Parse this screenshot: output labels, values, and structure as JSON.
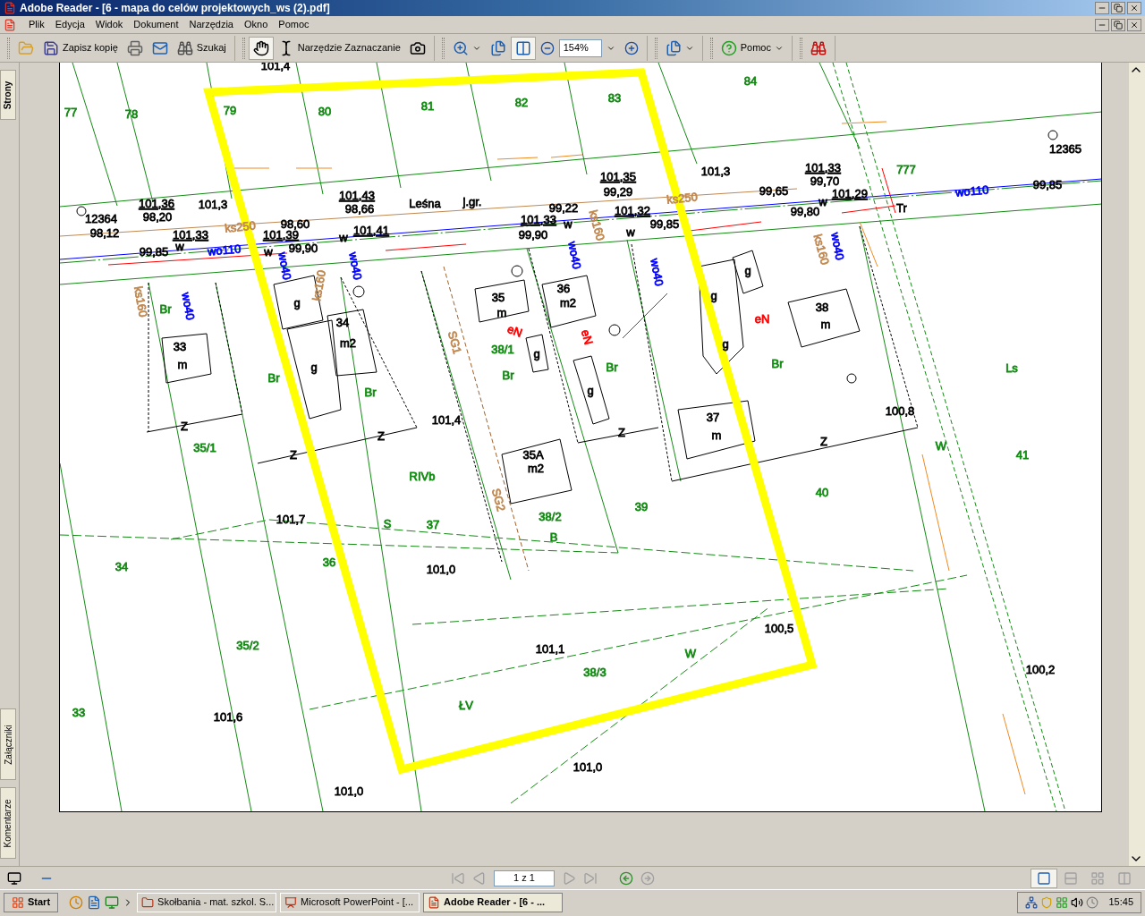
{
  "window": {
    "title": "Adobe Reader - [6 - mapa do celów projektowych_ws (2).pdf]"
  },
  "menu": [
    "Plik",
    "Edycja",
    "Widok",
    "Dokument",
    "Narzędzia",
    "Okno",
    "Pomoc"
  ],
  "toolbar": {
    "save_copy": "Zapisz kopię",
    "search": "Szukaj",
    "hand_selected": true,
    "select_tool": "Narzędzie Zaznaczanie",
    "zoom": "154%",
    "fit_width_selected": true,
    "help": "Pomoc"
  },
  "side_tabs_top": [
    "Strony"
  ],
  "side_tabs_bottom": [
    "Załączniki",
    "Komentarze"
  ],
  "map_labels": [
    {
      "text": "101,4",
      "color": "#000000"
    },
    {
      "text": "77",
      "color": "#138a13"
    },
    {
      "text": "78",
      "color": "#138a13"
    },
    {
      "text": "79",
      "color": "#138a13"
    },
    {
      "text": "80",
      "color": "#138a13"
    },
    {
      "text": "81",
      "color": "#138a13"
    },
    {
      "text": "82",
      "color": "#138a13"
    },
    {
      "text": "83",
      "color": "#138a13"
    },
    {
      "text": "84",
      "color": "#138a13"
    },
    {
      "text": "12364",
      "color": "#000000"
    },
    {
      "text": "98,12",
      "color": "#000000"
    },
    {
      "text": "101,36",
      "color": "#000000"
    },
    {
      "text": "98,20",
      "color": "#000000"
    },
    {
      "text": "101,3",
      "color": "#000000"
    },
    {
      "text": "ks250",
      "color": "#c08850"
    },
    {
      "text": "98,60",
      "color": "#000000"
    },
    {
      "text": "101,43",
      "color": "#000000"
    },
    {
      "text": "98,66",
      "color": "#000000"
    },
    {
      "text": "Leśna",
      "color": "#000000"
    },
    {
      "text": "j.gr.",
      "color": "#000000"
    },
    {
      "text": "101,33",
      "color": "#000000"
    },
    {
      "text": "w",
      "color": "#000000"
    },
    {
      "text": "99,85",
      "color": "#000000"
    },
    {
      "text": "wo110",
      "color": "#0000ff"
    },
    {
      "text": "101,39",
      "color": "#000000"
    },
    {
      "text": "w",
      "color": "#000000"
    },
    {
      "text": "99,90",
      "color": "#000000"
    },
    {
      "text": "w",
      "color": "#000000"
    },
    {
      "text": "101,41",
      "color": "#000000"
    },
    {
      "text": "99,22",
      "color": "#000000"
    },
    {
      "text": "101,33",
      "color": "#000000"
    },
    {
      "text": "w",
      "color": "#000000"
    },
    {
      "text": "99,90",
      "color": "#000000"
    },
    {
      "text": "101,35",
      "color": "#000000"
    },
    {
      "text": "99,29",
      "color": "#000000"
    },
    {
      "text": "101,32",
      "color": "#000000"
    },
    {
      "text": "w",
      "color": "#000000"
    },
    {
      "text": "99,85",
      "color": "#000000"
    },
    {
      "text": "ks250",
      "color": "#c08850"
    },
    {
      "text": "101,3",
      "color": "#000000"
    },
    {
      "text": "99,65",
      "color": "#000000"
    },
    {
      "text": "101,33",
      "color": "#000000"
    },
    {
      "text": "99,70",
      "color": "#000000"
    },
    {
      "text": "101,29",
      "color": "#000000"
    },
    {
      "text": "w",
      "color": "#000000"
    },
    {
      "text": "99,80",
      "color": "#000000"
    },
    {
      "text": "777",
      "color": "#138a13"
    },
    {
      "text": "Tr",
      "color": "#000000"
    },
    {
      "text": "wo110",
      "color": "#0000ff"
    },
    {
      "text": "99,85",
      "color": "#000000"
    },
    {
      "text": "12365",
      "color": "#000000"
    },
    {
      "text": "ks160",
      "color": "#c08850"
    },
    {
      "text": "wo40",
      "color": "#0000ff"
    },
    {
      "text": "wo40",
      "color": "#0000ff"
    },
    {
      "text": "ks160",
      "color": "#c08850"
    },
    {
      "text": "wo40",
      "color": "#0000ff"
    },
    {
      "text": "ks160",
      "color": "#c08850"
    },
    {
      "text": "wo40",
      "color": "#0000ff"
    },
    {
      "text": "wo40",
      "color": "#0000ff"
    },
    {
      "text": "ks160",
      "color": "#c08850"
    },
    {
      "text": "wo40",
      "color": "#0000ff"
    },
    {
      "text": "Br",
      "color": "#138a13"
    },
    {
      "text": "33",
      "color": "#000000"
    },
    {
      "text": "m",
      "color": "#000000"
    },
    {
      "text": "g",
      "color": "#000000"
    },
    {
      "text": "34",
      "color": "#000000"
    },
    {
      "text": "m2",
      "color": "#000000"
    },
    {
      "text": "g",
      "color": "#000000"
    },
    {
      "text": "Br",
      "color": "#138a13"
    },
    {
      "text": "Br",
      "color": "#138a13"
    },
    {
      "text": "35",
      "color": "#000000"
    },
    {
      "text": "m",
      "color": "#000000"
    },
    {
      "text": "eN",
      "color": "#ff0000"
    },
    {
      "text": "38/1",
      "color": "#138a13"
    },
    {
      "text": "g",
      "color": "#000000"
    },
    {
      "text": "SG1",
      "color": "#c08850"
    },
    {
      "text": "Br",
      "color": "#138a13"
    },
    {
      "text": "36",
      "color": "#000000"
    },
    {
      "text": "m2",
      "color": "#000000"
    },
    {
      "text": "eN",
      "color": "#ff0000"
    },
    {
      "text": "Br",
      "color": "#138a13"
    },
    {
      "text": "g",
      "color": "#000000"
    },
    {
      "text": "g",
      "color": "#000000"
    },
    {
      "text": "g",
      "color": "#000000"
    },
    {
      "text": "g",
      "color": "#000000"
    },
    {
      "text": "eN",
      "color": "#ff0000"
    },
    {
      "text": "38",
      "color": "#000000"
    },
    {
      "text": "m",
      "color": "#000000"
    },
    {
      "text": "Br",
      "color": "#138a13"
    },
    {
      "text": "Ls",
      "color": "#138a13"
    },
    {
      "text": "37",
      "color": "#000000"
    },
    {
      "text": "m",
      "color": "#000000"
    },
    {
      "text": "100,8",
      "color": "#000000"
    },
    {
      "text": "101,4",
      "color": "#000000"
    },
    {
      "text": "35A",
      "color": "#000000"
    },
    {
      "text": "m2",
      "color": "#000000"
    },
    {
      "text": "Z",
      "color": "#000000"
    },
    {
      "text": "Z",
      "color": "#000000"
    },
    {
      "text": "Z",
      "color": "#000000"
    },
    {
      "text": "Z",
      "color": "#000000"
    },
    {
      "text": "Z",
      "color": "#000000"
    },
    {
      "text": "35/1",
      "color": "#138a13"
    },
    {
      "text": "RIVb",
      "color": "#138a13"
    },
    {
      "text": "SG2",
      "color": "#c08850"
    },
    {
      "text": "38/2",
      "color": "#138a13"
    },
    {
      "text": "B",
      "color": "#138a13"
    },
    {
      "text": "39",
      "color": "#138a13"
    },
    {
      "text": "40",
      "color": "#138a13"
    },
    {
      "text": "41",
      "color": "#138a13"
    },
    {
      "text": "W",
      "color": "#138a13"
    },
    {
      "text": "101,7",
      "color": "#000000"
    },
    {
      "text": "S",
      "color": "#138a13"
    },
    {
      "text": "37",
      "color": "#138a13"
    },
    {
      "text": "34",
      "color": "#138a13"
    },
    {
      "text": "36",
      "color": "#138a13"
    },
    {
      "text": "101,0",
      "color": "#000000"
    },
    {
      "text": "35/2",
      "color": "#138a13"
    },
    {
      "text": "101,1",
      "color": "#000000"
    },
    {
      "text": "38/3",
      "color": "#138a13"
    },
    {
      "text": "W",
      "color": "#138a13"
    },
    {
      "text": "100,5",
      "color": "#000000"
    },
    {
      "text": "100,2",
      "color": "#000000"
    },
    {
      "text": "33",
      "color": "#138a13"
    },
    {
      "text": "101,6",
      "color": "#000000"
    },
    {
      "text": "ŁV",
      "color": "#138a13"
    },
    {
      "text": "101,0",
      "color": "#000000"
    },
    {
      "text": "101,0",
      "color": "#000000"
    }
  ],
  "status_bar": {
    "page": "1 z 1",
    "layouts": [
      {
        "kind": "single",
        "selected": true
      },
      {
        "kind": "continuous",
        "selected": false
      },
      {
        "kind": "facing",
        "selected": false
      },
      {
        "kind": "cover",
        "selected": false
      }
    ]
  },
  "taskbar": {
    "start": "Start",
    "tasks": [
      {
        "label": "Skołbania - mat. szkol. S...",
        "kind": "folder",
        "selected": false
      },
      {
        "label": "Microsoft PowerPoint - [...",
        "kind": "slides",
        "selected": false
      },
      {
        "label": "Adobe Reader - [6 - ...",
        "kind": "reader",
        "selected": true
      }
    ],
    "clock": "15:45"
  }
}
